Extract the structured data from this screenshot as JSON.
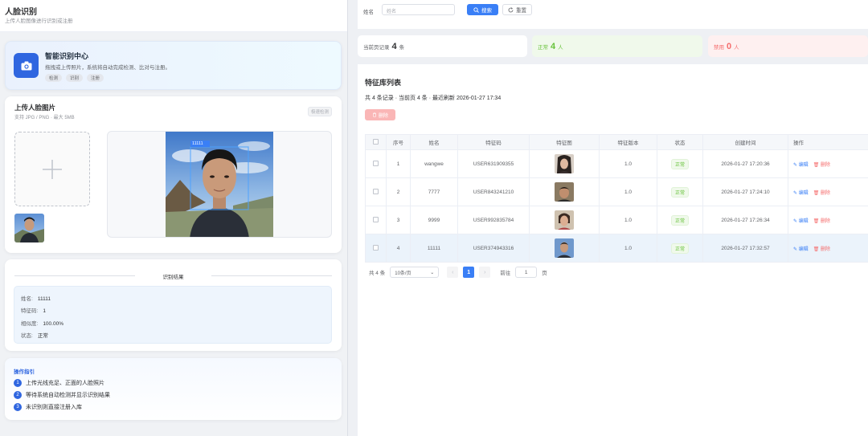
{
  "page": {
    "title": "人脸识别",
    "subtitle": "上传人脸图像进行识别或注册"
  },
  "hero": {
    "title": "智能识别中心",
    "desc": "拖拽或上传照片，系统将自动完成检测、比对与注册。",
    "tags": [
      "检测",
      "识别",
      "注册"
    ]
  },
  "upload": {
    "title": "上传人脸图片",
    "sub": "支持 JPG / PNG · 最大 5MB",
    "badge": "极速检测",
    "face_label": "11111"
  },
  "result": {
    "divider": "识别结果",
    "rows": [
      {
        "k": "姓名:",
        "v": "11111"
      },
      {
        "k": "特征码:",
        "v": "1"
      },
      {
        "k": "相似度:",
        "v": "100.00%"
      },
      {
        "k": "状态:",
        "v": "正常"
      }
    ]
  },
  "guide": {
    "title": "操作指引",
    "items": [
      "上传光线充足、正面的人脸照片",
      "等待系统自动检测并显示识别结果",
      "未识别则直接注册入库"
    ]
  },
  "search": {
    "label": "姓名",
    "placeholder": "姓名",
    "search_btn": "搜索",
    "reset_btn": "重置"
  },
  "stats": {
    "current_label": "当前页记录",
    "current_value": "4",
    "current_unit": "条",
    "normal_label": "正常",
    "normal_value": "4",
    "normal_unit": "人",
    "disabled_label": "禁用",
    "disabled_value": "0",
    "disabled_unit": "人"
  },
  "table": {
    "title": "特征库列表",
    "info": "共 4 条记录 · 当前页 4 条 · 最近刷新 2026-01-27 17:34",
    "delete_btn": "删除",
    "headers": [
      "序号",
      "姓名",
      "特征码",
      "特征图",
      "特征版本",
      "状态",
      "创建时间",
      "操作"
    ],
    "rows": [
      {
        "idx": "1",
        "name": "wangwe",
        "code": "USER631909355",
        "ver": "1.0",
        "status": "正常",
        "time": "2026-01-27 17:20:36"
      },
      {
        "idx": "2",
        "name": "7777",
        "code": "USER843241210",
        "ver": "1.0",
        "status": "正常",
        "time": "2026-01-27 17:24:10"
      },
      {
        "idx": "3",
        "name": "9999",
        "code": "USER992835784",
        "ver": "1.0",
        "status": "正常",
        "time": "2026-01-27 17:26:34"
      },
      {
        "idx": "4",
        "name": "11111",
        "code": "USER374943316",
        "ver": "1.0",
        "status": "正常",
        "time": "2026-01-27 17:32:57"
      }
    ],
    "edit_label": "编辑",
    "del_label": "删除"
  },
  "pager": {
    "total": "共 4 条",
    "size": "10条/页",
    "current": "1",
    "goto": "前往",
    "goto_value": "1",
    "page_unit": "页"
  },
  "colors": {
    "primary": "#3a7ff6",
    "success": "#67c23a",
    "danger": "#f56c6c"
  }
}
